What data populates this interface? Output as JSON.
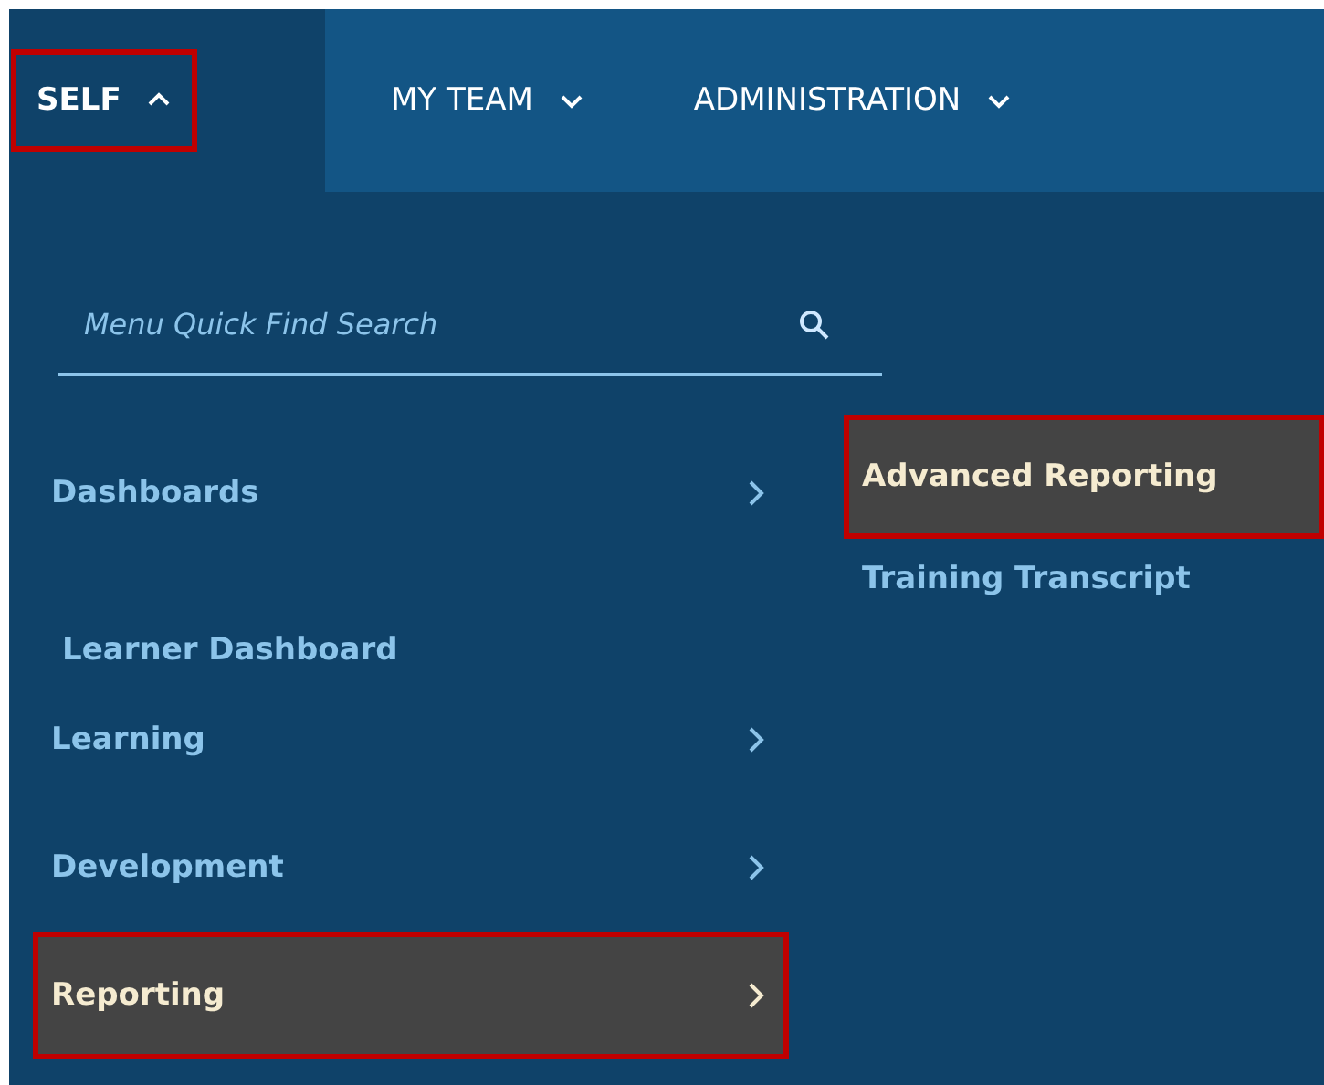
{
  "nav": {
    "tabs": [
      {
        "label": "SELF",
        "selected": true,
        "expanded": true,
        "highlighted": true
      },
      {
        "label": "MY TEAM",
        "selected": false,
        "expanded": false,
        "highlighted": false
      },
      {
        "label": "ADMINISTRATION",
        "selected": false,
        "expanded": false,
        "highlighted": false
      }
    ]
  },
  "search": {
    "placeholder": "Menu Quick Find Search"
  },
  "menu": {
    "items": [
      {
        "label": "Dashboards",
        "kind": "group",
        "selected": false,
        "highlighted": false
      },
      {
        "label": "Learner Dashboard",
        "kind": "link",
        "selected": false,
        "highlighted": false
      },
      {
        "label": "Learning",
        "kind": "group",
        "selected": false,
        "highlighted": false
      },
      {
        "label": "Development",
        "kind": "group",
        "selected": false,
        "highlighted": false
      },
      {
        "label": "Reporting",
        "kind": "group",
        "selected": true,
        "highlighted": true
      }
    ]
  },
  "submenu": {
    "items": [
      {
        "label": "Advanced Reporting",
        "selected": true,
        "highlighted": true
      },
      {
        "label": "Training Transcript",
        "selected": false,
        "highlighted": false
      }
    ]
  }
}
